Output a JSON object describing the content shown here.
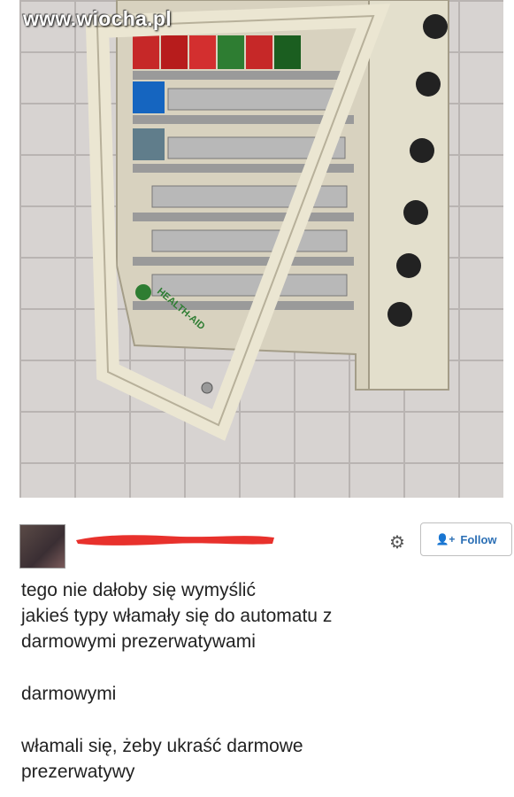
{
  "watermark": "www.wiocha.pl",
  "photo": {
    "machine_label": "HEALTH-AID"
  },
  "post": {
    "follow_label": "Follow",
    "lines": [
      "tego nie dałoby się wymyślić",
      "jakieś typy włamały się do automatu z",
      "darmowymi prezerwatywami",
      "darmowymi",
      "włamali się, żeby ukraść darmowe",
      "prezerwatywy"
    ]
  },
  "colors": {
    "follow": "#2b6fb5",
    "redaction": "#e8312c"
  },
  "icons": [
    "gear-icon",
    "add-user-icon"
  ]
}
